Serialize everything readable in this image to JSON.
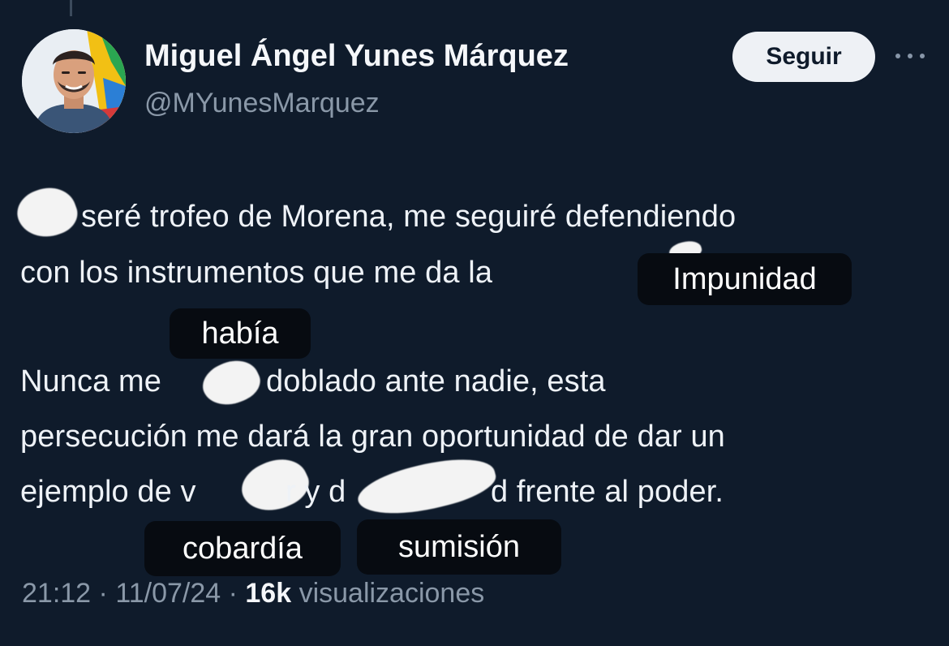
{
  "tweet": {
    "author_name": "Miguel Ángel Yunes Márquez",
    "author_handle": "@MYunesMarquez",
    "follow_label": "Seguir",
    "line1": "seré trofeo de Morena, me seguiré defendiendo",
    "line2": "con los instrumentos que me da la",
    "line3a": "Nunca me",
    "line3b": "doblado ante nadie, esta",
    "line4": "persecución me dará la gran oportunidad de dar un",
    "line5a": "ejemplo de v",
    "line5b": "r y d",
    "line5c": "d frente al poder."
  },
  "labels": {
    "impunidad": "Impunidad",
    "habia": "había",
    "cobardia": "cobardía",
    "sumision": "sumisión"
  },
  "meta": {
    "time": "21:12",
    "date": "11/07/24",
    "views_count": "16k",
    "views_label": "visualizaciones"
  },
  "icons": {
    "more": "more-horizontal-icon"
  },
  "colors": {
    "background": "#0f1b2b",
    "follow_button": "#eef1f5",
    "muted_text": "#8a98a8",
    "label_bg": "#070b11"
  }
}
